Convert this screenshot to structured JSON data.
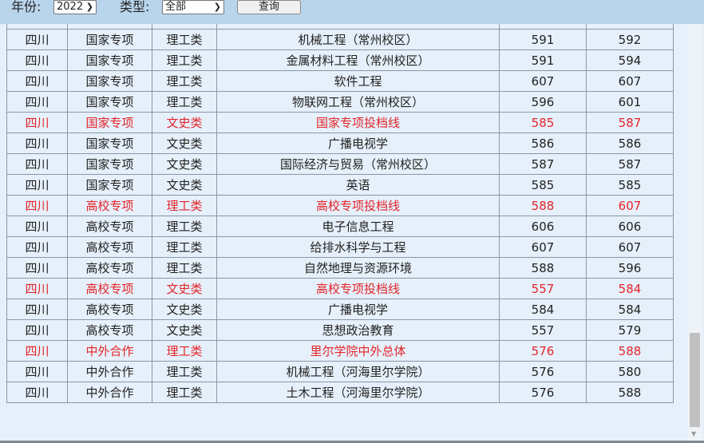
{
  "filter": {
    "year_label": "年份:",
    "year_value": "2022",
    "type_label": "类型:",
    "type_value": "全部",
    "query_button": "查询"
  },
  "colors": {
    "highlight": "#e3252b",
    "topbar": "#b9d5ec",
    "background": "#e6f0fa"
  },
  "rows": [
    {
      "province": "四川",
      "category": "国家专项",
      "subject": "理工类",
      "major": "机械工程（常州校区）",
      "min": "591",
      "max": "592",
      "highlight": false
    },
    {
      "province": "四川",
      "category": "国家专项",
      "subject": "理工类",
      "major": "金属材料工程（常州校区）",
      "min": "591",
      "max": "594",
      "highlight": false
    },
    {
      "province": "四川",
      "category": "国家专项",
      "subject": "理工类",
      "major": "软件工程",
      "min": "607",
      "max": "607",
      "highlight": false
    },
    {
      "province": "四川",
      "category": "国家专项",
      "subject": "理工类",
      "major": "物联网工程（常州校区）",
      "min": "596",
      "max": "601",
      "highlight": false
    },
    {
      "province": "四川",
      "category": "国家专项",
      "subject": "文史类",
      "major": "国家专项投档线",
      "min": "585",
      "max": "587",
      "highlight": true
    },
    {
      "province": "四川",
      "category": "国家专项",
      "subject": "文史类",
      "major": "广播电视学",
      "min": "586",
      "max": "586",
      "highlight": false
    },
    {
      "province": "四川",
      "category": "国家专项",
      "subject": "文史类",
      "major": "国际经济与贸易（常州校区）",
      "min": "587",
      "max": "587",
      "highlight": false
    },
    {
      "province": "四川",
      "category": "国家专项",
      "subject": "文史类",
      "major": "英语",
      "min": "585",
      "max": "585",
      "highlight": false
    },
    {
      "province": "四川",
      "category": "高校专项",
      "subject": "理工类",
      "major": "高校专项投档线",
      "min": "588",
      "max": "607",
      "highlight": true
    },
    {
      "province": "四川",
      "category": "高校专项",
      "subject": "理工类",
      "major": "电子信息工程",
      "min": "606",
      "max": "606",
      "highlight": false
    },
    {
      "province": "四川",
      "category": "高校专项",
      "subject": "理工类",
      "major": "给排水科学与工程",
      "min": "607",
      "max": "607",
      "highlight": false
    },
    {
      "province": "四川",
      "category": "高校专项",
      "subject": "理工类",
      "major": "自然地理与资源环境",
      "min": "588",
      "max": "596",
      "highlight": false
    },
    {
      "province": "四川",
      "category": "高校专项",
      "subject": "文史类",
      "major": "高校专项投档线",
      "min": "557",
      "max": "584",
      "highlight": true
    },
    {
      "province": "四川",
      "category": "高校专项",
      "subject": "文史类",
      "major": "广播电视学",
      "min": "584",
      "max": "584",
      "highlight": false
    },
    {
      "province": "四川",
      "category": "高校专项",
      "subject": "文史类",
      "major": "思想政治教育",
      "min": "557",
      "max": "579",
      "highlight": false
    },
    {
      "province": "四川",
      "category": "中外合作",
      "subject": "理工类",
      "major": "里尔学院中外总体",
      "min": "576",
      "max": "588",
      "highlight": true
    },
    {
      "province": "四川",
      "category": "中外合作",
      "subject": "理工类",
      "major": "机械工程（河海里尔学院）",
      "min": "576",
      "max": "580",
      "highlight": false
    },
    {
      "province": "四川",
      "category": "中外合作",
      "subject": "理工类",
      "major": "土木工程（河海里尔学院）",
      "min": "576",
      "max": "588",
      "highlight": false
    }
  ]
}
